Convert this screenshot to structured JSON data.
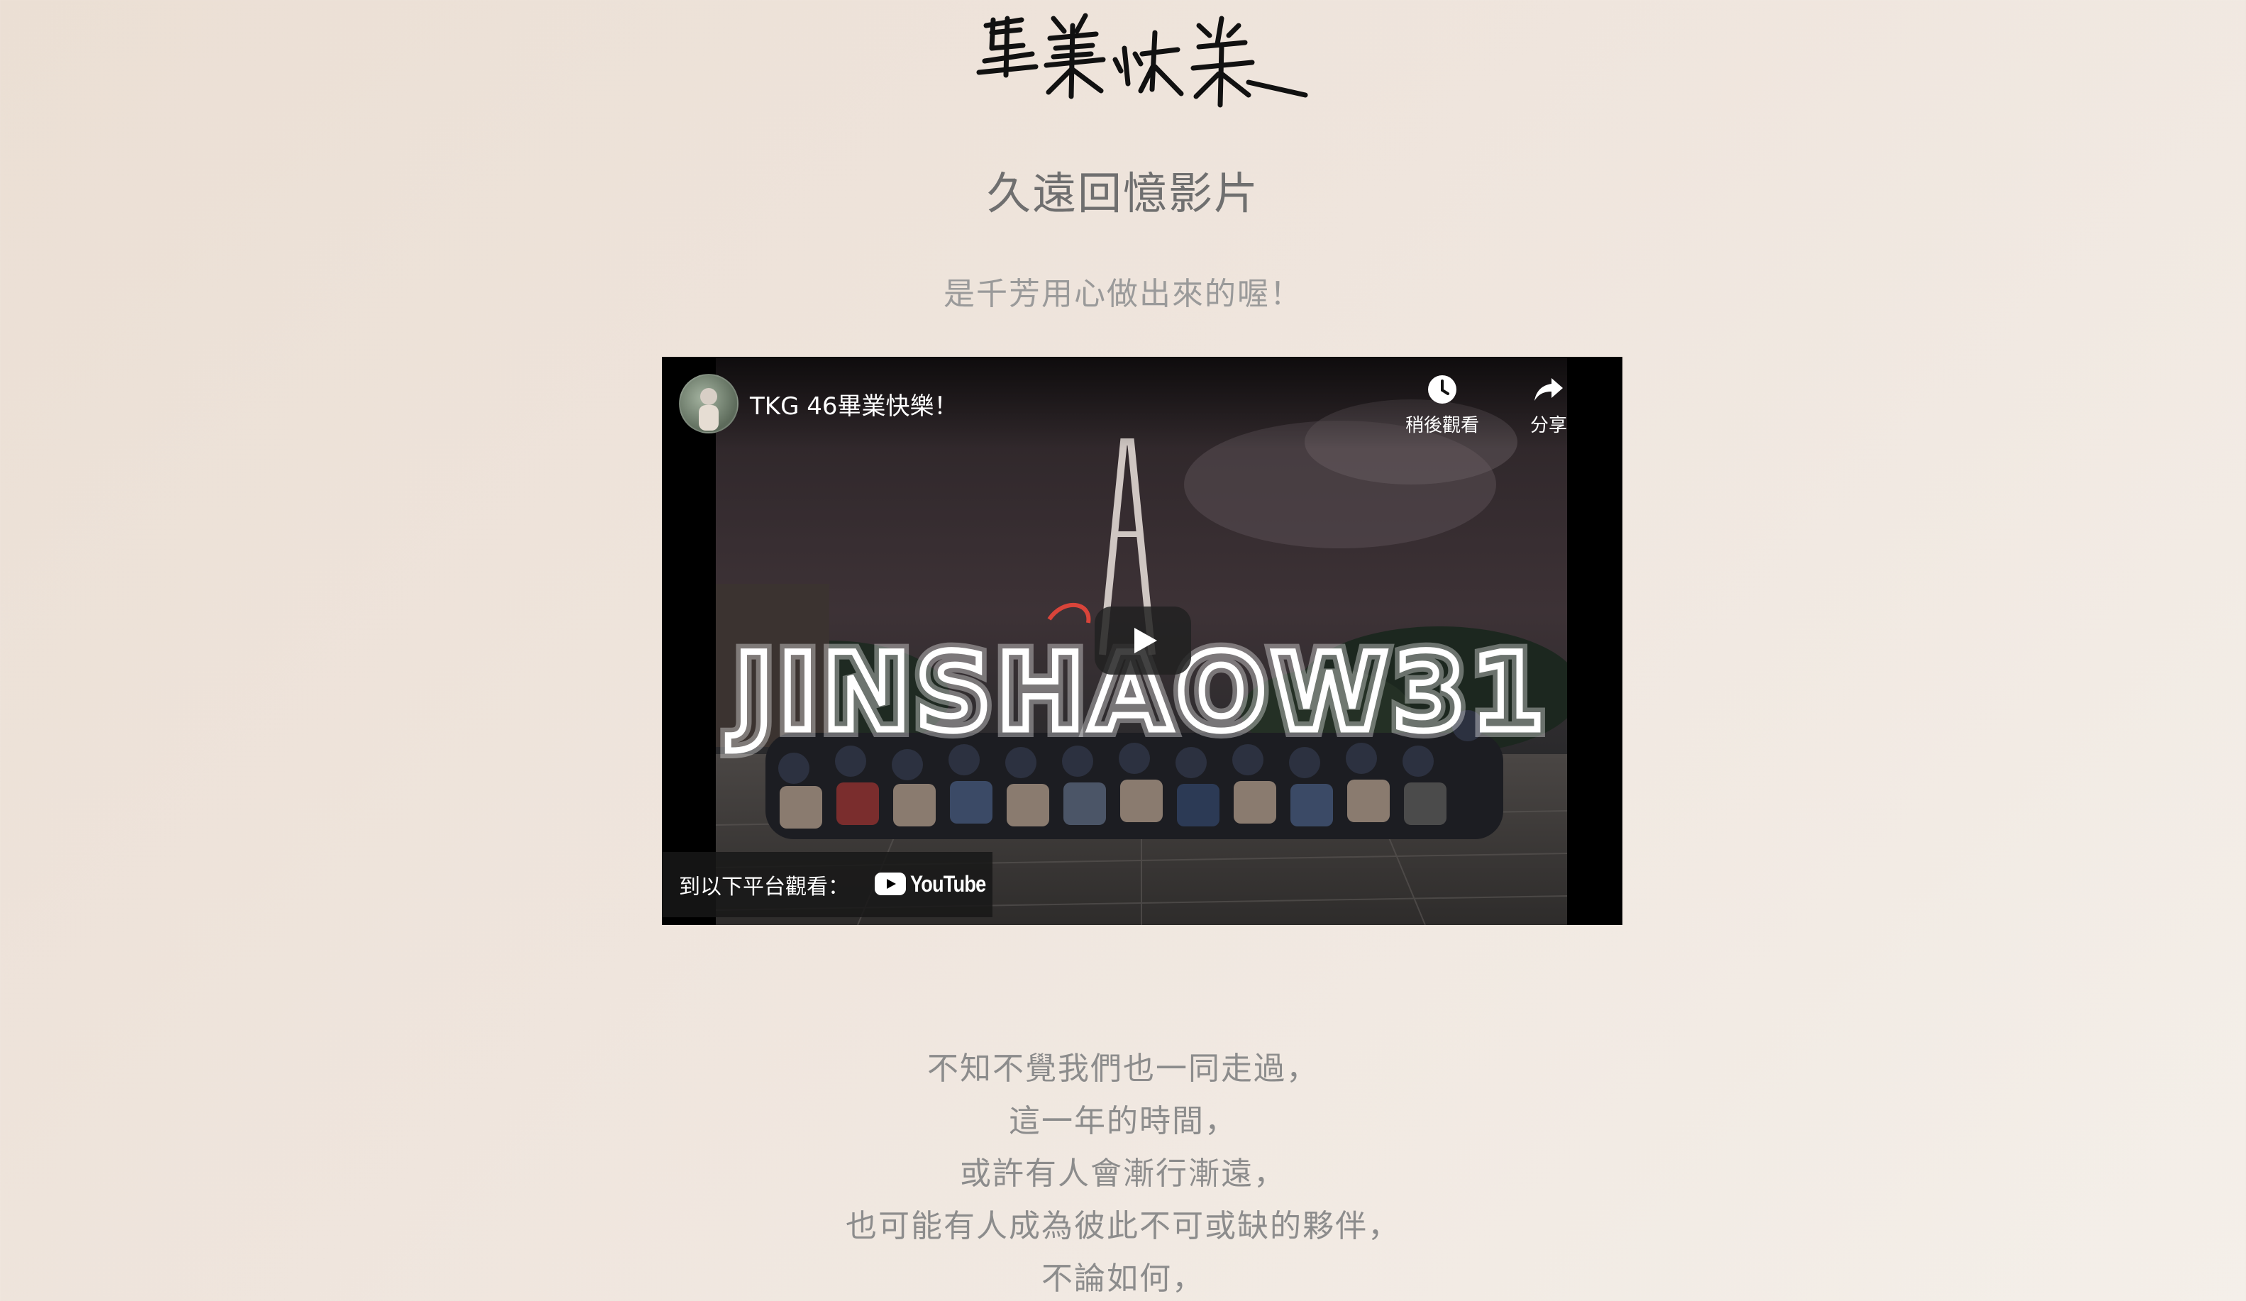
{
  "logo": {
    "text": "畢業快樂",
    "icon": "handwritten-title-logo"
  },
  "header": {
    "title": "久遠回憶影片",
    "subtitle": "是千芳用心做出來的喔！"
  },
  "video": {
    "title": "TKG 46畢業快樂！",
    "avatar_icon": "channel-avatar",
    "actions": {
      "watch_later_label": "稍後觀看",
      "watch_later_icon": "clock-icon",
      "share_label": "分享",
      "share_icon": "share-arrow-icon"
    },
    "play_icon": "play-icon",
    "watch_on_label": "到以下平台觀看：",
    "platform": "YouTube",
    "thumbnail_text": "JINSHAOW31"
  },
  "poem": {
    "lines": [
      "不知不覺我們也一同走過，",
      "這一年的時間，",
      "或許有人會漸行漸遠，",
      "也可能有人成為彼此不可或缺的夥伴，",
      "不論如何，"
    ]
  },
  "colors": {
    "background": "#ece1d7",
    "title_text": "#6f6f6f",
    "subtitle_text": "#9a9a9a",
    "poem_text": "#8c8c8c",
    "video_bg": "#000000"
  }
}
